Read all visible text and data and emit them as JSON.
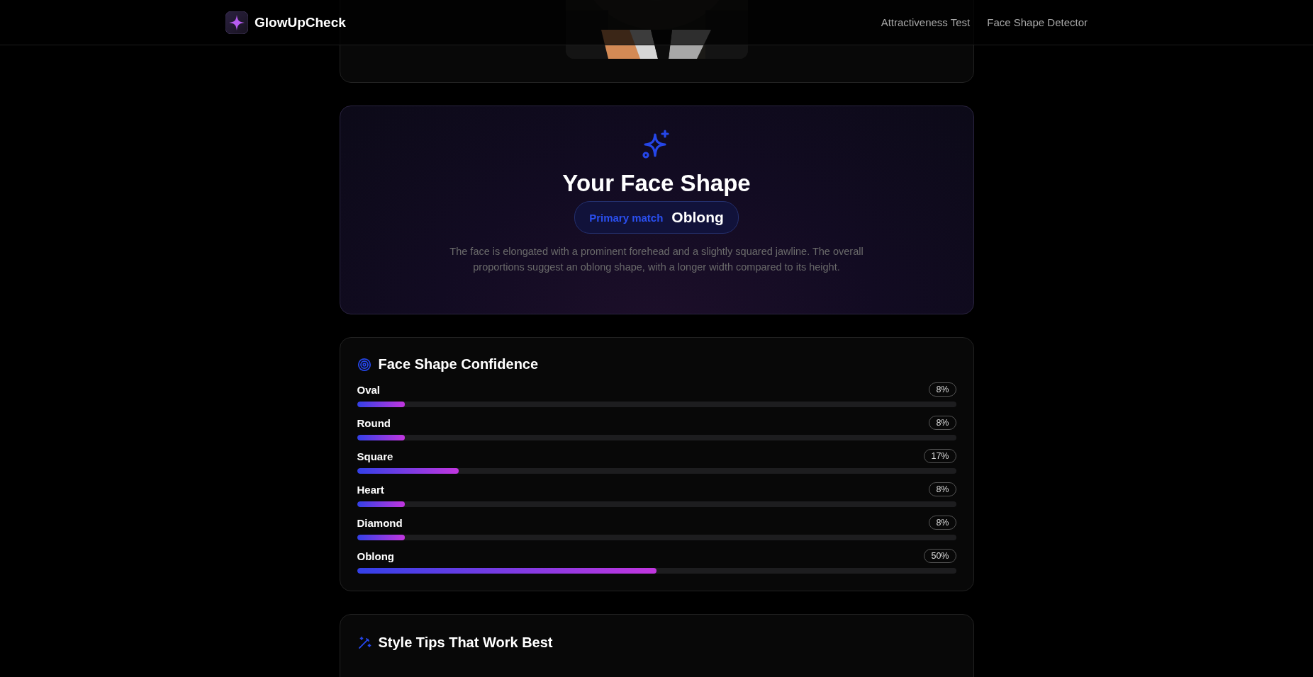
{
  "header": {
    "brand": "GlowUpCheck",
    "nav": [
      {
        "label": "Attractiveness Test"
      },
      {
        "label": "Face Shape Detector"
      }
    ]
  },
  "result": {
    "title": "Your Face Shape",
    "match_label": "Primary match",
    "match_value": "Oblong",
    "description": "The face is elongated with a prominent forehead and a slightly squared jawline. The overall proportions suggest an oblong shape, with a longer width compared to its height."
  },
  "confidence": {
    "title": "Face Shape Confidence",
    "rows": [
      {
        "name": "Oval",
        "level": 0.08,
        "reading": "8%"
      },
      {
        "name": "Round",
        "level": 0.08,
        "reading": "8%"
      },
      {
        "name": "Square",
        "level": 0.17,
        "reading": "17%"
      },
      {
        "name": "Heart",
        "level": 0.08,
        "reading": "8%"
      },
      {
        "name": "Diamond",
        "level": 0.08,
        "reading": "8%"
      },
      {
        "name": "Oblong",
        "level": 0.5,
        "reading": "50%"
      }
    ]
  },
  "tips": {
    "title": "Style Tips That Work Best"
  }
}
